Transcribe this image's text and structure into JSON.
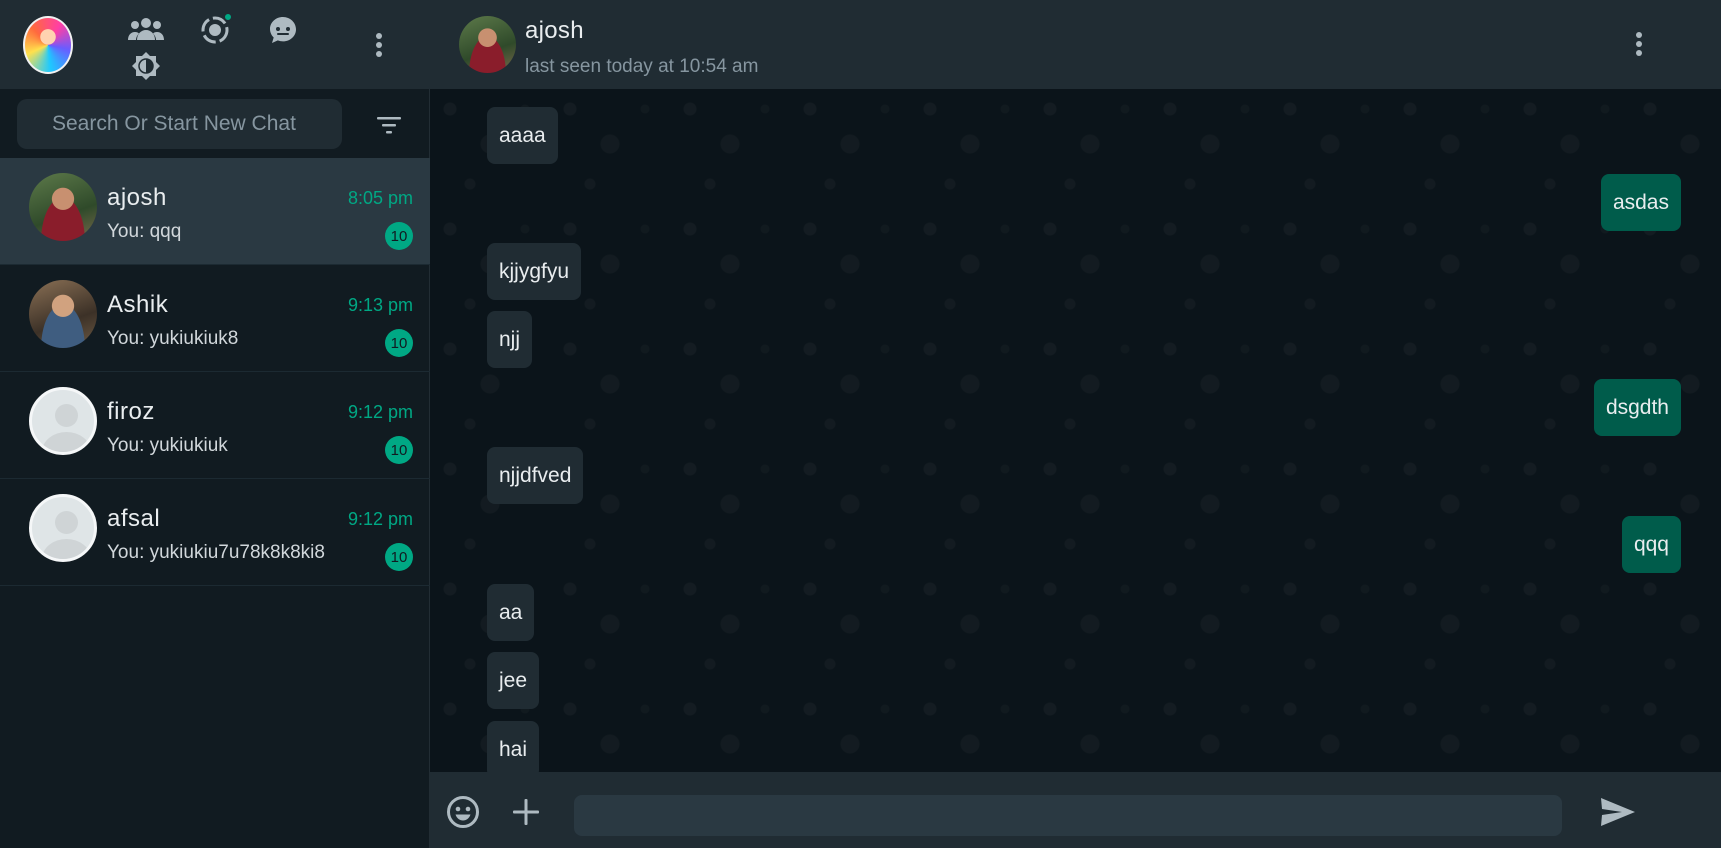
{
  "sidebar": {
    "search": {
      "placeholder": "Search Or Start New Chat"
    },
    "chats": [
      {
        "name": "ajosh",
        "time": "8:05 pm",
        "last": "You: qqq",
        "unread": "10"
      },
      {
        "name": "Ashik",
        "time": "9:13 pm",
        "last": "You: yukiukiuk8",
        "unread": "10"
      },
      {
        "name": "firoz",
        "time": "9:12 pm",
        "last": "You: yukiukiuk",
        "unread": "10"
      },
      {
        "name": "afsal",
        "time": "9:12 pm",
        "last": "You: yukiukiu7u78k8k8ki8",
        "unread": "10"
      }
    ]
  },
  "header": {
    "contact_name": "ajosh",
    "status": "last seen today at 10:54 am"
  },
  "messages": [
    {
      "text": "aaaa",
      "direction": "in"
    },
    {
      "text": "asdas",
      "direction": "out"
    },
    {
      "text": "kjjygfyu",
      "direction": "in"
    },
    {
      "text": "njj",
      "direction": "in"
    },
    {
      "text": "dsgdth",
      "direction": "out"
    },
    {
      "text": "njjdfved",
      "direction": "in"
    },
    {
      "text": "qqq",
      "direction": "out"
    },
    {
      "text": "aa",
      "direction": "in"
    },
    {
      "text": "jee",
      "direction": "in"
    },
    {
      "text": "hai",
      "direction": "in"
    }
  ],
  "composer": {
    "value": ""
  },
  "colors": {
    "accent": "#00a884",
    "panel": "#202c33",
    "background": "#111b21",
    "outgoing_bubble": "#005c4b",
    "incoming_bubble": "#202c33"
  },
  "icons": [
    "community-icon",
    "status-icon",
    "channels-icon",
    "menu-dots-icon",
    "theme-toggle-icon",
    "filter-icon",
    "emoji-icon",
    "attach-plus-icon",
    "send-icon"
  ]
}
